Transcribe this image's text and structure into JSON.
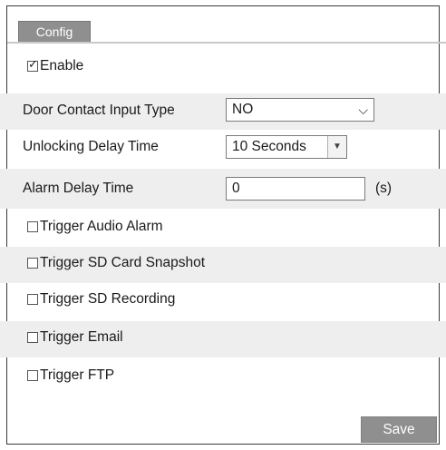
{
  "tabs": [
    {
      "label": "Config"
    }
  ],
  "enable": {
    "label": "Enable",
    "checked": true
  },
  "fields": {
    "door_contact_input_type": {
      "label": "Door Contact Input Type",
      "value": "NO"
    },
    "unlocking_delay_time": {
      "label": "Unlocking Delay Time",
      "value": "10 Seconds"
    },
    "alarm_delay_time": {
      "label": "Alarm Delay Time",
      "value": "0",
      "unit": "(s)"
    }
  },
  "triggers": [
    {
      "label": "Trigger Audio Alarm",
      "checked": false
    },
    {
      "label": "Trigger SD Card Snapshot",
      "checked": false
    },
    {
      "label": "Trigger SD Recording",
      "checked": false
    },
    {
      "label": "Trigger Email",
      "checked": false
    },
    {
      "label": "Trigger FTP",
      "checked": false
    }
  ],
  "save_label": "Save"
}
